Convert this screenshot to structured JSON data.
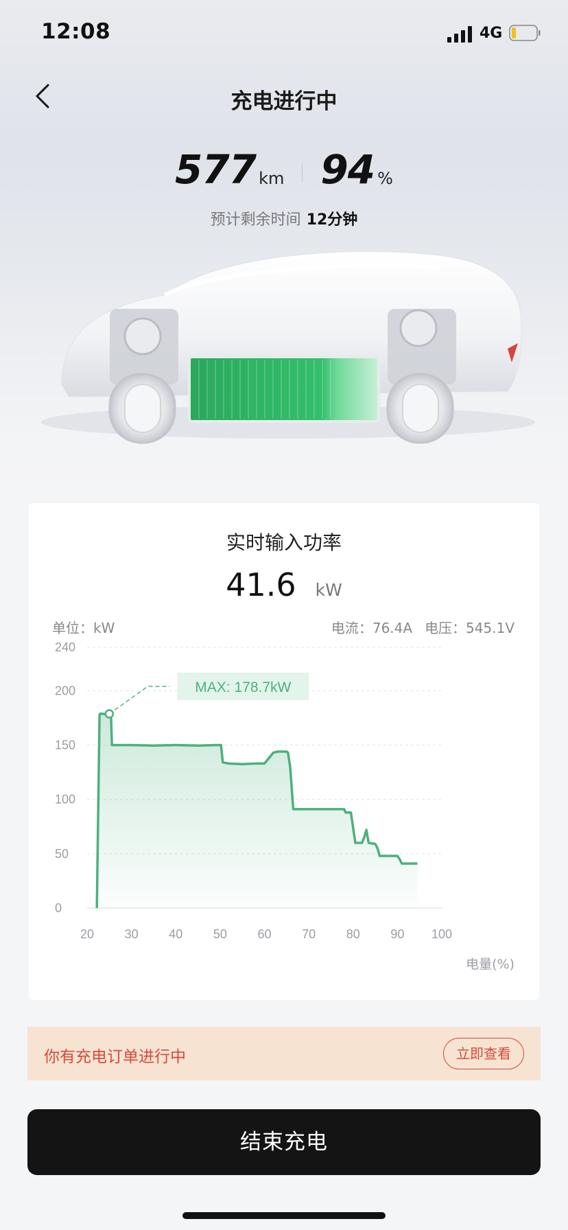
{
  "status_bar": {
    "time": "12:08",
    "network": "4G"
  },
  "nav": {
    "title": "充电进行中"
  },
  "stats": {
    "range_value": "577",
    "range_unit": "km",
    "battery_value": "94",
    "battery_unit": "%",
    "eta_label": "预计剩余时间",
    "eta_value": "12分钟"
  },
  "power_card": {
    "title": "实时输入功率",
    "value": "41.6",
    "unit": "kW",
    "unit_label": "单位：kW",
    "current": "电流：76.4A",
    "voltage": "电压：545.1V"
  },
  "chart_data": {
    "type": "line",
    "xlabel": "电量(%)",
    "ylabel": "",
    "xlim": [
      20,
      100
    ],
    "ylim": [
      0,
      240
    ],
    "x_ticks": [
      "20",
      "30",
      "40",
      "50",
      "60",
      "70",
      "80",
      "90",
      "100"
    ],
    "y_ticks": [
      "240",
      "200",
      "150",
      "100",
      "50",
      "0"
    ],
    "grid": true,
    "line_color": "#4cb07e",
    "annotation": {
      "text": "MAX: 178.7kW",
      "x": 25,
      "y": 178.7
    },
    "series": [
      {
        "x": [
          22.2,
          22.8,
          23.0,
          24.0,
          24.5,
          25.0,
          25.4,
          25.6,
          30,
          35,
          40,
          45,
          49,
          50.2,
          50.6,
          52,
          55,
          58,
          60,
          61,
          62,
          63,
          65,
          65.3,
          65.8,
          66.5,
          70,
          75,
          78,
          78.3,
          79.5,
          80.5,
          82,
          82.5,
          83,
          83.5,
          85,
          85.5,
          86,
          90,
          90.5,
          91,
          93,
          94.5
        ],
        "y": [
          0,
          178,
          179,
          178.5,
          178,
          178.7,
          176,
          150,
          150,
          149.5,
          150,
          149.5,
          150,
          150,
          134,
          133,
          132.5,
          133,
          133,
          138,
          143,
          144,
          144,
          143,
          130,
          91,
          91,
          91,
          91,
          88,
          88,
          60,
          60,
          65,
          72,
          60,
          59,
          55,
          48,
          48,
          45,
          41,
          41,
          41
        ]
      }
    ]
  }
}
